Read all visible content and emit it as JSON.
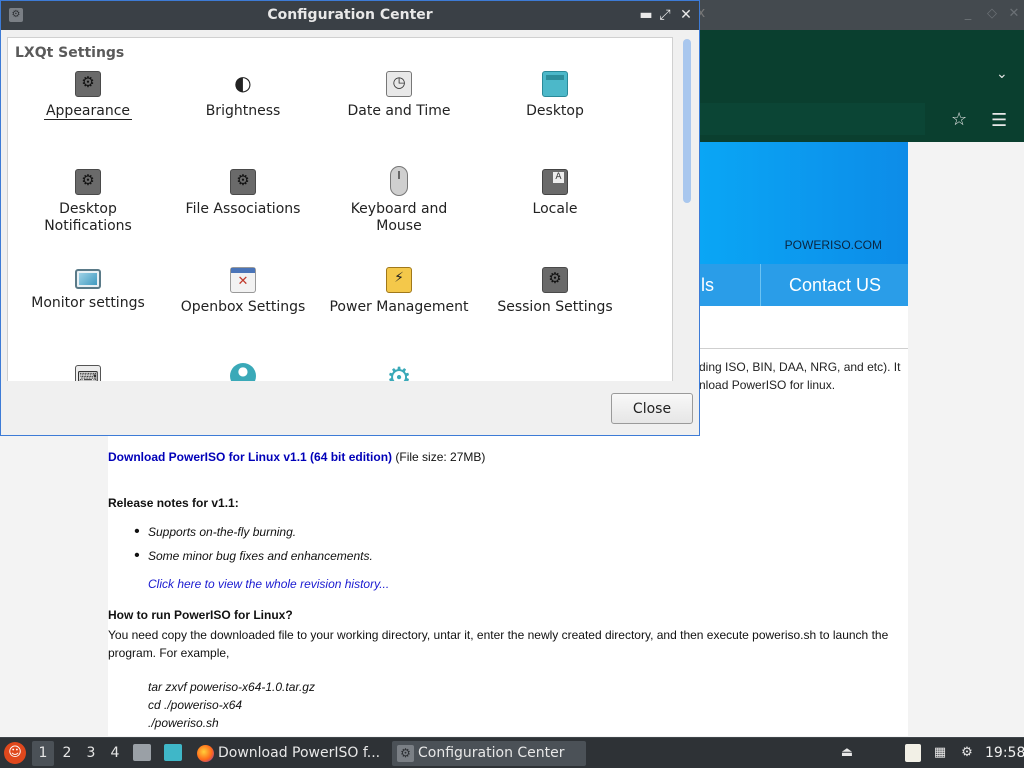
{
  "browser": {
    "brand": "POWERISO.COM",
    "nav_tab_partial": "ls",
    "nav_contact": "Contact US",
    "intro_line1": "ding ISO, BIN, DAA, NRG, and etc). It",
    "intro_line2": "nload PowerISO for linux.",
    "download_link": "Download PowerISO for Linux v1.1 (64 bit edition)",
    "file_size": " (File size: 27MB)",
    "release_heading": "Release notes for v1.1:",
    "release_notes": [
      "Supports on-the-fly burning.",
      "Some minor bug fixes and enhancements."
    ],
    "revision_link": "Click here to view the whole revision history...",
    "howto_heading": "How to run PowerISO for Linux?",
    "howto_text1": "You need copy the downloaded file to your working directory, untar it, enter the newly created directory, and then execute poweriso.sh to launch the",
    "howto_text2": "program. For example,",
    "commands": [
      "tar zxvf poweriso-x64-1.0.tar.gz",
      "cd ./poweriso-x64",
      "./poweriso.sh"
    ]
  },
  "window": {
    "title": "Configuration Center",
    "category": "LXQt Settings",
    "close_label": "Close",
    "items": [
      {
        "label": "Appearance",
        "icon": "appearance-icon"
      },
      {
        "label": "Brightness",
        "icon": "brightness-icon"
      },
      {
        "label": "Date and Time",
        "icon": "clock-icon"
      },
      {
        "label": "Desktop",
        "icon": "desktop-icon"
      },
      {
        "label": "Desktop Notifications",
        "icon": "notifications-icon"
      },
      {
        "label": "File Associations",
        "icon": "file-associations-icon"
      },
      {
        "label": "Keyboard and Mouse",
        "icon": "mouse-icon"
      },
      {
        "label": "Locale",
        "icon": "locale-icon"
      },
      {
        "label": "Monitor settings",
        "icon": "monitor-icon"
      },
      {
        "label": "Openbox Settings",
        "icon": "openbox-icon"
      },
      {
        "label": "Power Management",
        "icon": "power-icon"
      },
      {
        "label": "Session Settings",
        "icon": "session-icon"
      }
    ]
  },
  "taskbar": {
    "workspaces": [
      "1",
      "2",
      "3",
      "4"
    ],
    "tasks": [
      {
        "label": "Download PowerISO f...",
        "icon": "firefox-icon"
      },
      {
        "label": "Configuration Center",
        "icon": "settings-icon"
      }
    ],
    "clock": "19:58"
  },
  "colors": {
    "accent": "#3d7bd6",
    "browser_green": "#0a3f2f",
    "banner_blue": "#0aa6f5",
    "link_blue": "#0000b8"
  }
}
